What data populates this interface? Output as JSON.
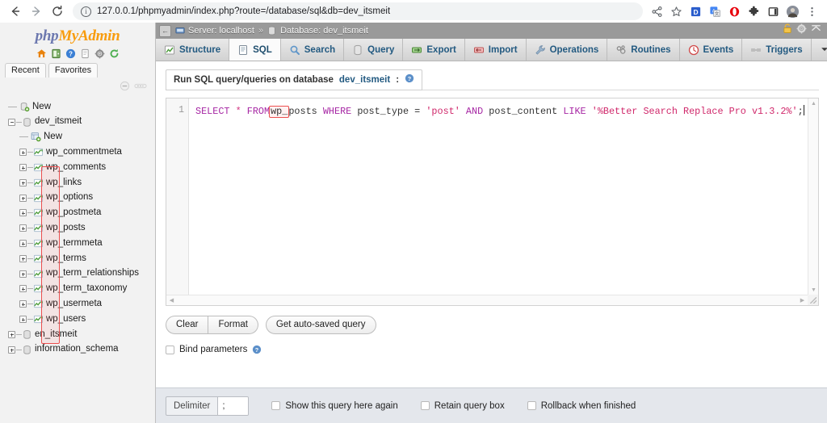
{
  "browser": {
    "back_icon": "back-arrow-icon",
    "forward_icon": "forward-arrow-icon",
    "reload_icon": "reload-icon",
    "info_glyph": "i",
    "url": "127.0.0.1/phpmyadmin/index.php?route=/database/sql&db=dev_itsmeit",
    "toolbar_icons": [
      {
        "name": "share-icon",
        "glyph": "<"
      },
      {
        "name": "bookmark-star-icon",
        "glyph": "☆"
      },
      {
        "name": "extension-d-icon",
        "glyph": "D"
      },
      {
        "name": "translate-icon",
        "glyph": "文"
      },
      {
        "name": "opera-extension-icon",
        "glyph": "O"
      },
      {
        "name": "puzzle-extensions-icon",
        "glyph": "✷"
      },
      {
        "name": "sidepanel-icon",
        "glyph": "▣"
      },
      {
        "name": "profile-avatar-icon",
        "glyph": "●"
      },
      {
        "name": "chrome-menu-icon",
        "glyph": "⋮"
      }
    ]
  },
  "sidebar": {
    "logo": {
      "php": "php",
      "my": "My",
      "admin": "Admin"
    },
    "logo_icons": [
      "home-icon",
      "server-icon",
      "help-icon",
      "documentation-icon",
      "settings-icon",
      "reload-nav-icon"
    ],
    "tabs": [
      {
        "label": "Recent",
        "name": "recent-tab"
      },
      {
        "label": "Favorites",
        "name": "favorites-tab"
      }
    ],
    "toggles": [
      "collapse-all-icon",
      "link-tables-icon"
    ],
    "tree": [
      {
        "label": "New",
        "depth": 1,
        "icon": "new-db-icon",
        "toggle": "none",
        "name": "tree-new-database"
      },
      {
        "label": "dev_itsmeit",
        "depth": 1,
        "icon": "database-icon",
        "toggle": "minus",
        "name": "tree-database-dev-itsmeit"
      },
      {
        "label": "New",
        "depth": 2,
        "icon": "new-table-icon",
        "toggle": "none",
        "name": "tree-new-table"
      },
      {
        "label": "wp_commentmeta",
        "depth": 2,
        "icon": "table-icon",
        "toggle": "plus",
        "name": "tree-table-wp-commentmeta"
      },
      {
        "label": "wp_comments",
        "depth": 2,
        "icon": "table-icon",
        "toggle": "plus",
        "name": "tree-table-wp-comments"
      },
      {
        "label": "wp_links",
        "depth": 2,
        "icon": "table-icon",
        "toggle": "plus",
        "name": "tree-table-wp-links"
      },
      {
        "label": "wp_options",
        "depth": 2,
        "icon": "table-icon",
        "toggle": "plus",
        "name": "tree-table-wp-options"
      },
      {
        "label": "wp_postmeta",
        "depth": 2,
        "icon": "table-icon",
        "toggle": "plus",
        "name": "tree-table-wp-postmeta"
      },
      {
        "label": "wp_posts",
        "depth": 2,
        "icon": "table-icon",
        "toggle": "plus",
        "name": "tree-table-wp-posts"
      },
      {
        "label": "wp_termmeta",
        "depth": 2,
        "icon": "table-icon",
        "toggle": "plus",
        "name": "tree-table-wp-termmeta"
      },
      {
        "label": "wp_terms",
        "depth": 2,
        "icon": "table-icon",
        "toggle": "plus",
        "name": "tree-table-wp-terms"
      },
      {
        "label": "wp_term_relationships",
        "depth": 2,
        "icon": "table-icon",
        "toggle": "plus",
        "name": "tree-table-wp-term-relationships"
      },
      {
        "label": "wp_term_taxonomy",
        "depth": 2,
        "icon": "table-icon",
        "toggle": "plus",
        "name": "tree-table-wp-term-taxonomy"
      },
      {
        "label": "wp_usermeta",
        "depth": 2,
        "icon": "table-icon",
        "toggle": "plus",
        "name": "tree-table-wp-usermeta"
      },
      {
        "label": "wp_users",
        "depth": 2,
        "icon": "table-icon",
        "toggle": "plus",
        "name": "tree-table-wp-users"
      },
      {
        "label": "en_itsmeit",
        "depth": 1,
        "icon": "database-icon",
        "toggle": "plus",
        "name": "tree-database-en-itsmeit"
      },
      {
        "label": "information_schema",
        "depth": 1,
        "icon": "database-icon",
        "toggle": "plus",
        "name": "tree-database-information-schema"
      }
    ]
  },
  "header": {
    "collapse_glyph": "←",
    "server_label": "Server: localhost",
    "separator": "»",
    "database_label": "Database: dev_itsmeit",
    "right_icons": [
      "unlock-icon",
      "settings-gear-icon",
      "collapse-up-icon"
    ]
  },
  "tabs": [
    {
      "label": "Structure",
      "icon": "structure-icon",
      "active": false,
      "name": "tab-structure"
    },
    {
      "label": "SQL",
      "icon": "sql-icon",
      "active": true,
      "name": "tab-sql"
    },
    {
      "label": "Search",
      "icon": "search-magnifier-icon",
      "active": false,
      "name": "tab-search"
    },
    {
      "label": "Query",
      "icon": "query-icon",
      "active": false,
      "name": "tab-query"
    },
    {
      "label": "Export",
      "icon": "export-icon",
      "active": false,
      "name": "tab-export"
    },
    {
      "label": "Import",
      "icon": "import-icon",
      "active": false,
      "name": "tab-import"
    },
    {
      "label": "Operations",
      "icon": "wrench-operations-icon",
      "active": false,
      "name": "tab-operations"
    },
    {
      "label": "Routines",
      "icon": "routines-icon",
      "active": false,
      "name": "tab-routines"
    },
    {
      "label": "Events",
      "icon": "clock-events-icon",
      "active": false,
      "name": "tab-events"
    },
    {
      "label": "Triggers",
      "icon": "triggers-icon",
      "active": false,
      "name": "tab-triggers"
    },
    {
      "label": "More",
      "icon": "chevron-down-icon",
      "active": false,
      "name": "tab-more"
    }
  ],
  "panel": {
    "title_prefix": "Run SQL query/queries on database",
    "title_db": "dev_itsmeit",
    "title_suffix": ":",
    "help_icon": "help-question-icon"
  },
  "editor": {
    "line_number": "1",
    "query_full": "SELECT * FROM wp_posts WHERE post_type = 'post' AND post_content LIKE '%Better Search Replace Pro v1.3.2%';",
    "tokens": {
      "select": "SELECT",
      "star": "*",
      "from": "FROM",
      "table_highlight": "wp_",
      "table_rest": "posts",
      "where": "WHERE",
      "col_post_type": "post_type",
      "eq": "=",
      "val_post": "'post'",
      "and": "AND",
      "col_post_content": "post_content",
      "like": "LIKE",
      "val_like": "'%Better Search Replace Pro v1.3.2%'",
      "semicolon": ";"
    },
    "scroll_up_glyph": "▲",
    "scroll_down_glyph": "▼",
    "scroll_left_glyph": "◀",
    "scroll_right_glyph": "▶"
  },
  "buttons": {
    "clear": "Clear",
    "format": "Format",
    "get_auto_saved": "Get auto-saved query"
  },
  "bind": {
    "label": "Bind parameters",
    "checked": false,
    "help_icon": "help-question-icon"
  },
  "bottom": {
    "delimiter_label": "Delimiter",
    "delimiter_value": ";",
    "checkboxes": [
      {
        "label": "Show this query here again",
        "checked": false,
        "name": "show-query-again-checkbox"
      },
      {
        "label": "Retain query box",
        "checked": false,
        "name": "retain-query-box-checkbox"
      },
      {
        "label": "Rollback when finished",
        "checked": false,
        "name": "rollback-when-finished-checkbox"
      }
    ]
  },
  "colors": {
    "accent_blue": "#235a81",
    "logo_orange": "#f89c0e",
    "logo_blue": "#6c78af",
    "annotation_red": "#ec4f4f",
    "topbar_gray": "#9a9a9a",
    "bottombar": "#e4e7ec"
  }
}
